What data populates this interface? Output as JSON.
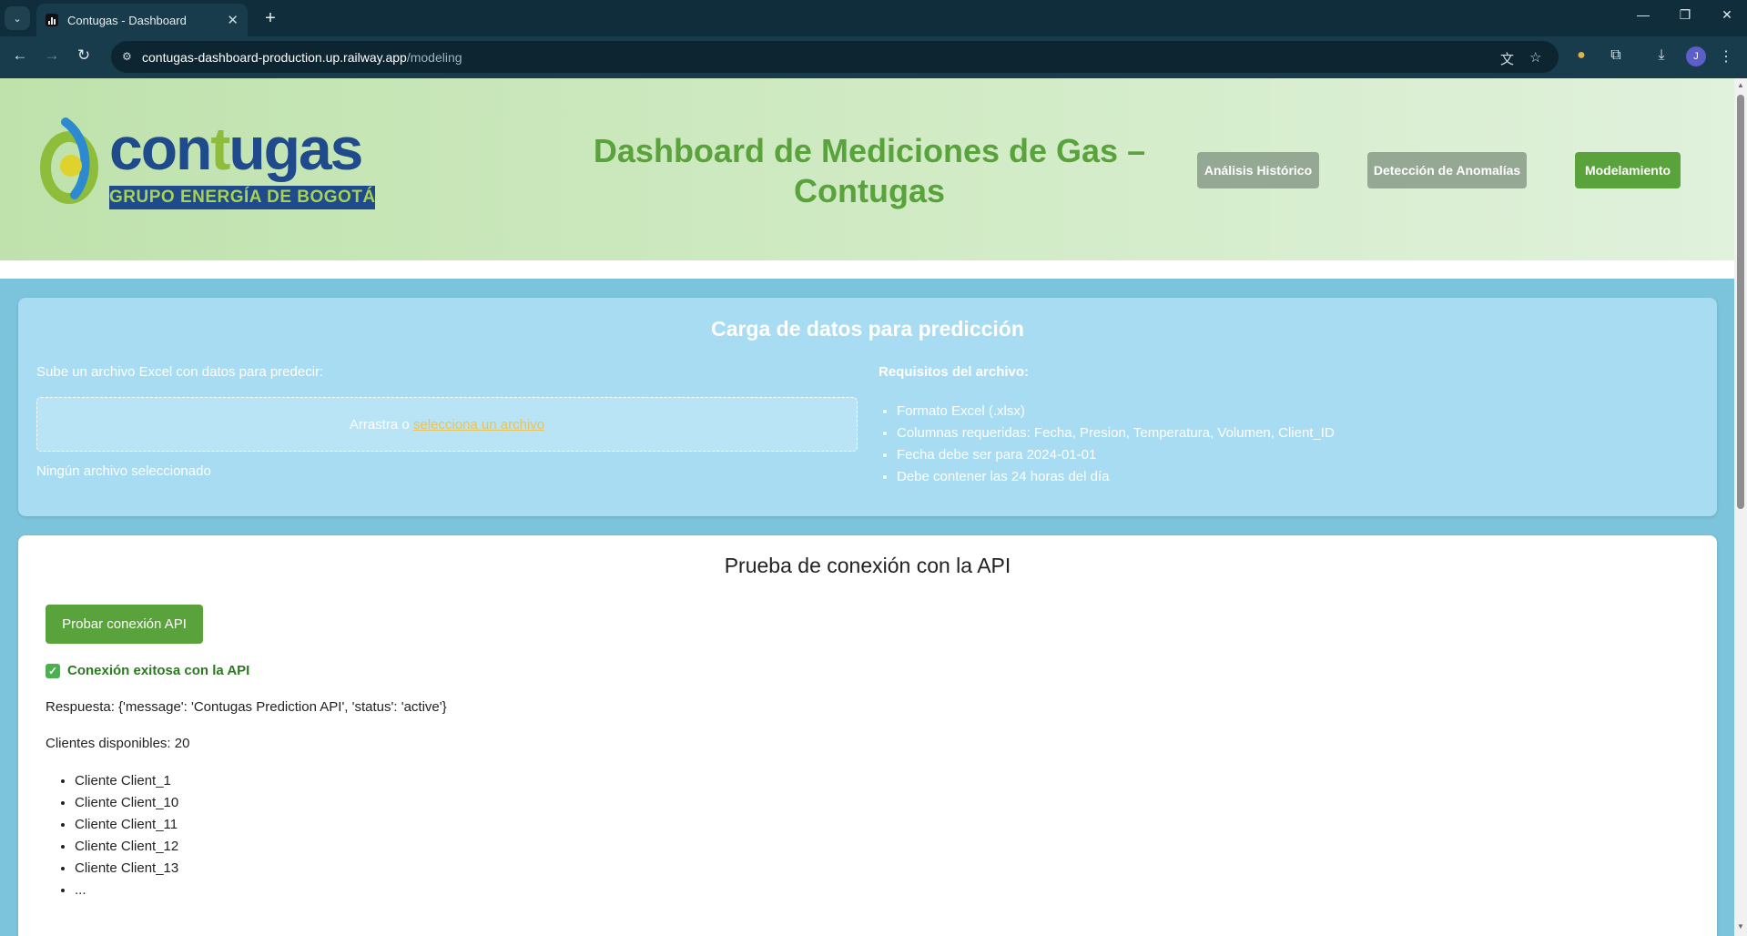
{
  "browser": {
    "tab_title": "Contugas - Dashboard",
    "url_host": "contugas-dashboard-production.up.railway.app",
    "url_path": "/modeling",
    "profile_initial": "J"
  },
  "header": {
    "logo_text_start": "con",
    "logo_text_accent": "t",
    "logo_text_end": "ugas",
    "logo_subtitle": "GRUPO ENERGÍA DE BOGOTÁ",
    "title": "Dashboard de Mediciones de Gas – Contugas",
    "nav": {
      "historico": "Análisis Histórico",
      "anomalias": "Detección de Anomalías",
      "modelamiento": "Modelamiento"
    },
    "colors": {
      "title": "#5aa23c",
      "active_nav": "#5aa23c",
      "inactive_nav": "#94a894"
    }
  },
  "upload": {
    "title": "Carga de datos para predicción",
    "label": "Sube un archivo Excel con datos para predecir:",
    "drop_text": "Arrastra o ",
    "drop_link": "selecciona un archivo",
    "no_file": "Ningún archivo seleccionado",
    "requirements_title": "Requisitos del archivo:",
    "requirements": [
      "Formato Excel (.xlsx)",
      "Columnas requeridas: Fecha, Presion, Temperatura, Volumen, Client_ID",
      "Fecha debe ser para 2024-01-01",
      "Debe contener las 24 horas del día"
    ]
  },
  "api": {
    "title": "Prueba de conexión con la API",
    "button": "Probar conexión API",
    "status": "Conexión exitosa con la API",
    "response": "Respuesta: {'message': 'Contugas Prediction API', 'status': 'active'}",
    "clients_count": "Clientes disponibles: 20",
    "clients": [
      "Cliente Client_1",
      "Cliente Client_10",
      "Cliente Client_11",
      "Cliente Client_12",
      "Cliente Client_13",
      "..."
    ]
  }
}
